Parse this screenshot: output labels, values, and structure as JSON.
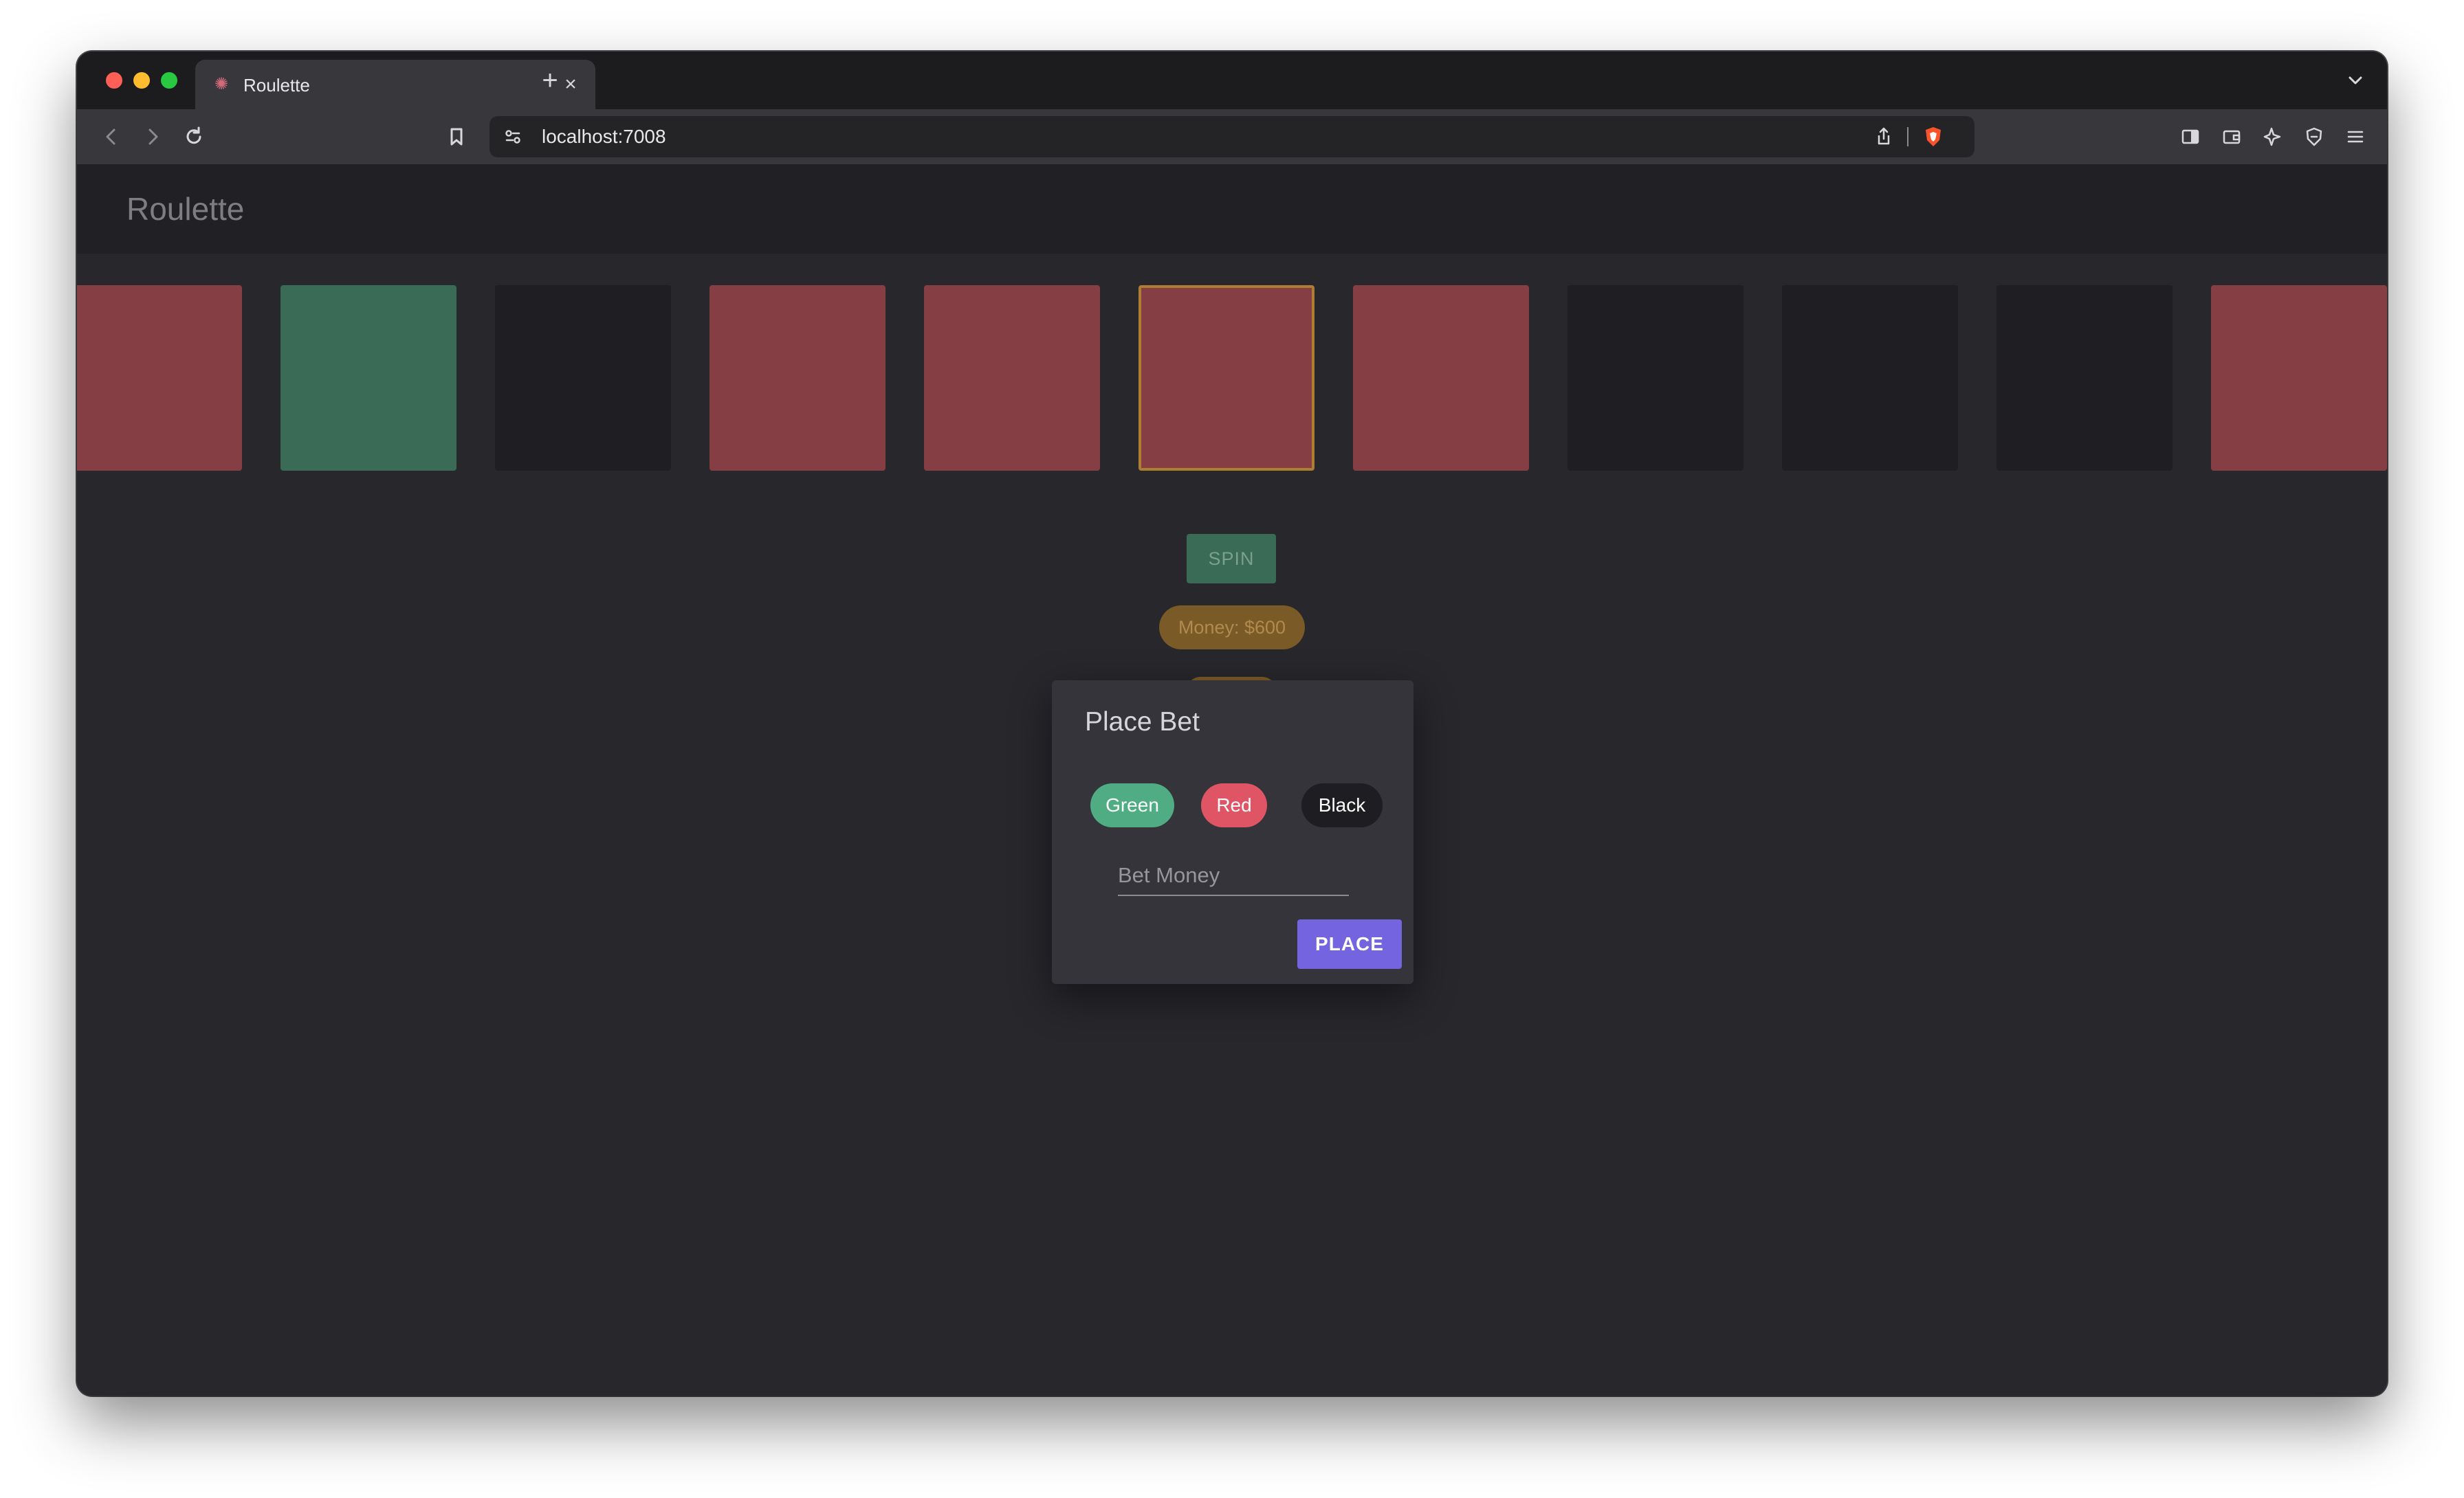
{
  "browser": {
    "tab_title": "Roulette",
    "url": "localhost:7008"
  },
  "app": {
    "title": "Roulette"
  },
  "wheel": {
    "slots": [
      {
        "color": "red"
      },
      {
        "color": "green"
      },
      {
        "color": "black"
      },
      {
        "color": "red"
      },
      {
        "color": "red"
      },
      {
        "color": "red",
        "selected": true
      },
      {
        "color": "red"
      },
      {
        "color": "black"
      },
      {
        "color": "black"
      },
      {
        "color": "black"
      },
      {
        "color": "red"
      }
    ]
  },
  "controls": {
    "spin_label": "SPIN",
    "money_label": "Money: $600"
  },
  "dialog": {
    "title": "Place Bet",
    "options": {
      "green": "Green",
      "red": "Red",
      "black": "Black"
    },
    "bet_placeholder": "Bet Money",
    "bet_value": "",
    "place_label": "PLACE"
  },
  "colors": {
    "red_slot": "#853f44",
    "green_slot": "#3a6b56",
    "black_slot": "#1f1f23",
    "selection_border": "#ad7d32",
    "place_button": "#7464df"
  }
}
